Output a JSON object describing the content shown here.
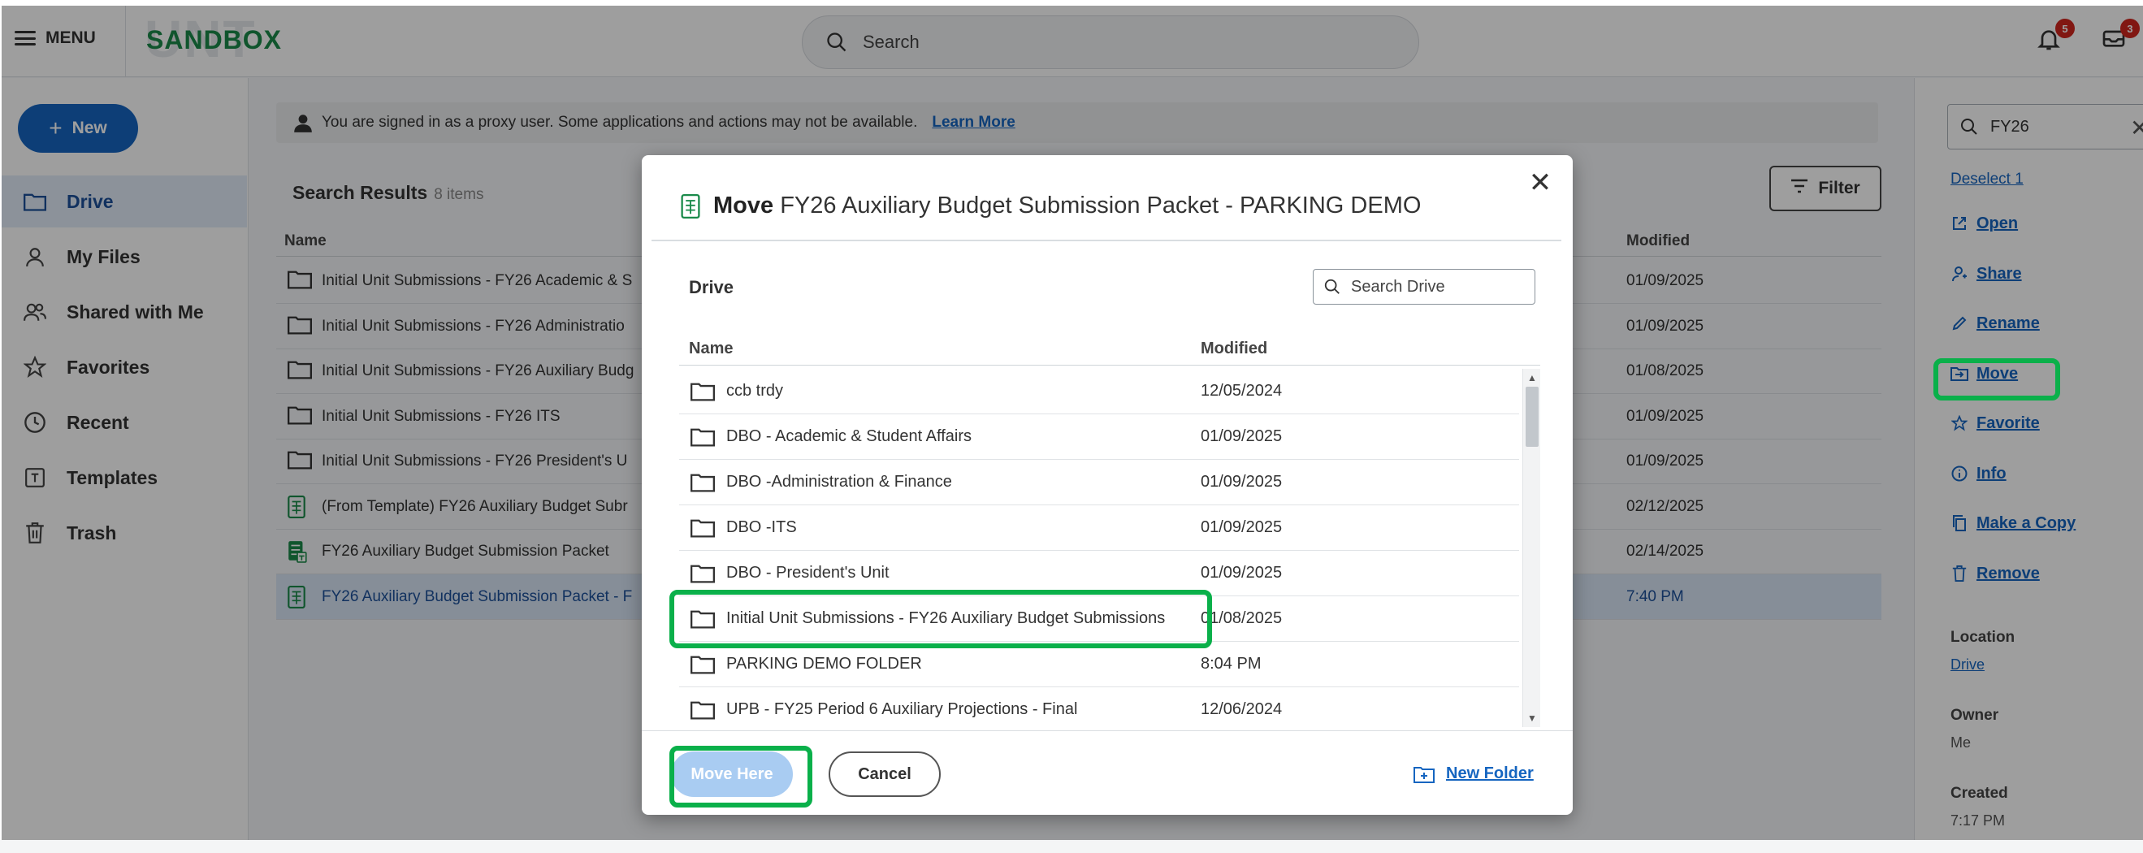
{
  "topbar": {
    "menu_label": "MENU",
    "logo_text": "SANDBOX",
    "logo_ghost": "UNT",
    "search_placeholder": "Search",
    "notifications_count": "5",
    "inbox_count": "3"
  },
  "sidebar": {
    "new_label": "New",
    "items": [
      {
        "label": "Drive",
        "icon": "folder-icon",
        "active": true
      },
      {
        "label": "My Files",
        "icon": "person-icon"
      },
      {
        "label": "Shared with Me",
        "icon": "shared-icon"
      },
      {
        "label": "Favorites",
        "icon": "star-icon"
      },
      {
        "label": "Recent",
        "icon": "clock-icon"
      },
      {
        "label": "Templates",
        "icon": "template-icon"
      },
      {
        "label": "Trash",
        "icon": "trash-icon"
      }
    ]
  },
  "proxy_banner": {
    "text": "You are signed in as a proxy user. Some applications and actions may not be available.",
    "link": "Learn More"
  },
  "results": {
    "title": "Search Results",
    "count": "8 items",
    "filter_label": "Filter",
    "col_name": "Name",
    "col_modified": "Modified",
    "rows": [
      {
        "name": "Initial Unit Submissions - FY26 Academic & S",
        "modified": "01/09/2025",
        "type": "folder"
      },
      {
        "name": "Initial Unit Submissions - FY26 Administratio",
        "modified": "01/09/2025",
        "type": "folder"
      },
      {
        "name": "Initial Unit Submissions - FY26 Auxiliary Budg",
        "modified": "01/08/2025",
        "type": "folder"
      },
      {
        "name": "Initial Unit Submissions - FY26 ITS",
        "modified": "01/09/2025",
        "type": "folder"
      },
      {
        "name": "Initial Unit Submissions - FY26 President's U",
        "modified": "01/09/2025",
        "type": "folder"
      },
      {
        "name": "(From Template) FY26 Auxiliary Budget Subr",
        "modified": "02/12/2025",
        "type": "sheet"
      },
      {
        "name": "FY26 Auxiliary Budget Submission Packet",
        "modified": "02/14/2025",
        "type": "template-sheet"
      },
      {
        "name": "FY26 Auxiliary Budget Submission Packet - F",
        "modified": "7:40 PM",
        "type": "sheet",
        "selected": true
      }
    ]
  },
  "right_panel": {
    "search_value": "FY26",
    "deselect": "Deselect 1",
    "actions": [
      {
        "label": "Open",
        "icon": "open-external-icon"
      },
      {
        "label": "Share",
        "icon": "share-person-icon"
      },
      {
        "label": "Rename",
        "icon": "pencil-icon"
      },
      {
        "label": "Move",
        "icon": "move-folder-icon"
      },
      {
        "label": "Favorite",
        "icon": "star-icon"
      },
      {
        "label": "Info",
        "icon": "info-icon"
      },
      {
        "label": "Make a Copy",
        "icon": "copy-icon"
      },
      {
        "label": "Remove",
        "icon": "trash-icon"
      }
    ],
    "location_label": "Location",
    "location_value": "Drive",
    "owner_label": "Owner",
    "owner_value": "Me",
    "created_label": "Created",
    "created_value": "7:17 PM"
  },
  "modal": {
    "title_bold": "Move",
    "title_rest": "FY26 Auxiliary Budget Submission Packet - PARKING DEMO",
    "breadcrumb": "Drive",
    "search_placeholder": "Search Drive",
    "col_name": "Name",
    "col_modified": "Modified",
    "rows": [
      {
        "name": "ccb trdy",
        "modified": "12/05/2024"
      },
      {
        "name": "DBO - Academic & Student Affairs",
        "modified": "01/09/2025"
      },
      {
        "name": "DBO -Administration & Finance",
        "modified": "01/09/2025"
      },
      {
        "name": "DBO -ITS",
        "modified": "01/09/2025"
      },
      {
        "name": "DBO - President's Unit",
        "modified": "01/09/2025"
      },
      {
        "name": "Initial Unit Submissions - FY26 Auxiliary Budget Submissions",
        "modified": "01/08/2025"
      },
      {
        "name": "PARKING DEMO FOLDER",
        "modified": "8:04 PM"
      },
      {
        "name": "UPB - FY25 Period 6 Auxiliary Projections - Final",
        "modified": "12/06/2024"
      }
    ],
    "move_label": "Move Here",
    "cancel_label": "Cancel",
    "new_folder_label": "New Folder"
  },
  "colors": {
    "accent": "#1565c0",
    "highlight": "#0ab04a",
    "brand": "#1a8a4a"
  }
}
